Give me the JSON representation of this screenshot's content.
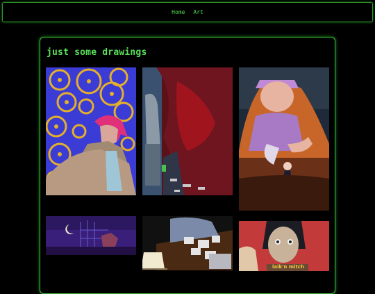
{
  "nav": {
    "items": [
      {
        "label": "Home"
      },
      {
        "label": "Art"
      }
    ]
  },
  "gallery": {
    "title": "just some drawings",
    "artworks": [
      {
        "name": "gears-redhead-drawing"
      },
      {
        "name": "red-curtain-drawing"
      },
      {
        "name": "maid-and-dancer-drawing"
      },
      {
        "name": "moonlit-night-drawing"
      },
      {
        "name": "desk-papers-drawing"
      },
      {
        "name": "portrait-caption-drawing",
        "caption": "laik'n mitch"
      }
    ]
  },
  "colors": {
    "accent": "#4fd64f",
    "border": "#3cbf3c",
    "background": "#000000"
  }
}
